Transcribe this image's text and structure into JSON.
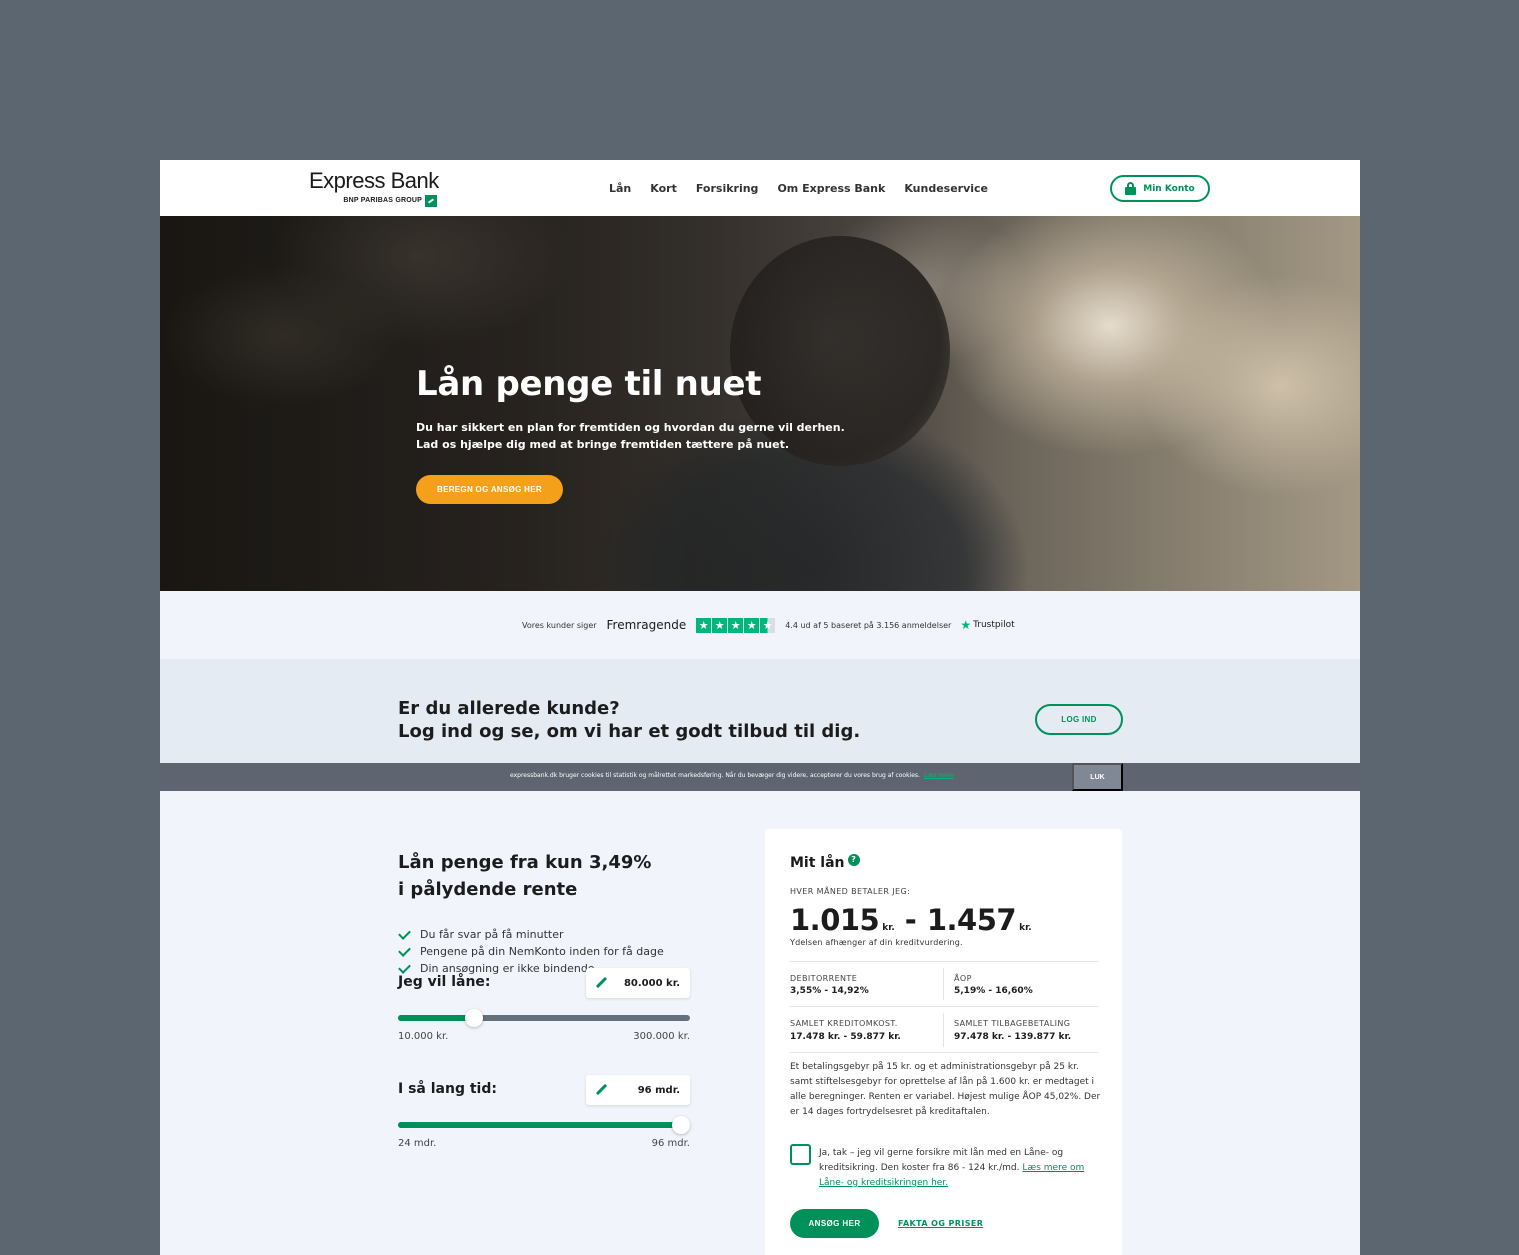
{
  "header": {
    "logo_name": "Express Bank",
    "logo_sub": "BNP PARIBAS GROUP",
    "nav": [
      "Lån",
      "Kort",
      "Forsikring",
      "Om Express Bank",
      "Kundeservice"
    ],
    "account_button": "Min Konto"
  },
  "hero": {
    "title": "Lån penge til nuet",
    "line1": "Du har sikkert en plan for fremtiden og hvordan du gerne vil derhen.",
    "line2": "Lad os hjælpe dig med at bringe fremtiden tættere på nuet.",
    "cta": "BEREGN OG ANSØG HER"
  },
  "trustpilot": {
    "prefix": "Vores kunder siger",
    "rating_word": "Fremragende",
    "stars": 4.5,
    "score_text": "4.4 ud af 5 baseret på 3.156 anmeldelser",
    "brand": "Trustpilot"
  },
  "customer_band": {
    "line1": "Er du allerede kunde?",
    "line2": "Log ind og se, om vi har et godt tilbud til dig.",
    "button": "LOG IND"
  },
  "cookie": {
    "message": "expressbank.dk bruger cookies til statistik og målrettet markedsføring. Når du bevæger dig videre, accepterer du vores brug af cookies.",
    "more_link": "Læs mere",
    "close": "LUK"
  },
  "calculator": {
    "title": "Lån penge fra kun 3,49% i pålydende rente",
    "benefits": [
      "Du får svar på få minutter",
      "Pengene på din NemKonto inden for få dage",
      "Din ansøgning er ikke bindende"
    ],
    "amount": {
      "label": "Jeg vil låne:",
      "value": "80.000 kr.",
      "min": "10.000 kr.",
      "max": "300.000 kr.",
      "fraction": 0.259
    },
    "duration": {
      "label": "I så lang tid:",
      "value": "96 mdr.",
      "min": "24 mdr.",
      "max": "96 mdr.",
      "fraction": 1.0
    }
  },
  "loan_card": {
    "title": "Mit lån",
    "monthly_caption": "HVER MÅNED BETALER JEG:",
    "monthly_low": "1.015",
    "monthly_high": "1.457",
    "currency": "kr.",
    "dash": "-",
    "note": "Ydelsen afhænger af din kreditvurdering.",
    "debit_label": "DEBITORRENTE",
    "debit_value": "3,55% - 14,92%",
    "aop_label": "ÅOP",
    "aop_value": "5,19% - 16,60%",
    "credit_cost_label": "SAMLET KREDITOMKOST.",
    "credit_cost_value": "17.478 kr. - 59.877 kr.",
    "repayment_label": "SAMLET TILBAGEBETALING",
    "repayment_value": "97.478 kr. - 139.877 kr.",
    "fine_print": "Et betalingsgebyr på 15 kr. og et administrationsgebyr på 25 kr. samt stiftelsesgebyr for oprettelse af lån på 1.600 kr. er medtaget i alle beregninger. Renten er variabel. Højest mulige ÅOP 45,02%. Der er 14 dages fortrydelsesret på kreditaftalen.",
    "insurance_text": "Ja, tak – jeg vil gerne forsikre mit lån med en Låne- og kreditsikring. Den koster fra 86 - 124 kr./md.",
    "insurance_link": "Læs mere om Låne- og kreditsikringen her.",
    "apply_button": "ANSØG HER",
    "facts_link": "FAKTA OG PRISER"
  },
  "colors": {
    "brand_green": "#00915a",
    "cta_orange": "#f5a01a",
    "trustpilot_green": "#00b67a"
  }
}
